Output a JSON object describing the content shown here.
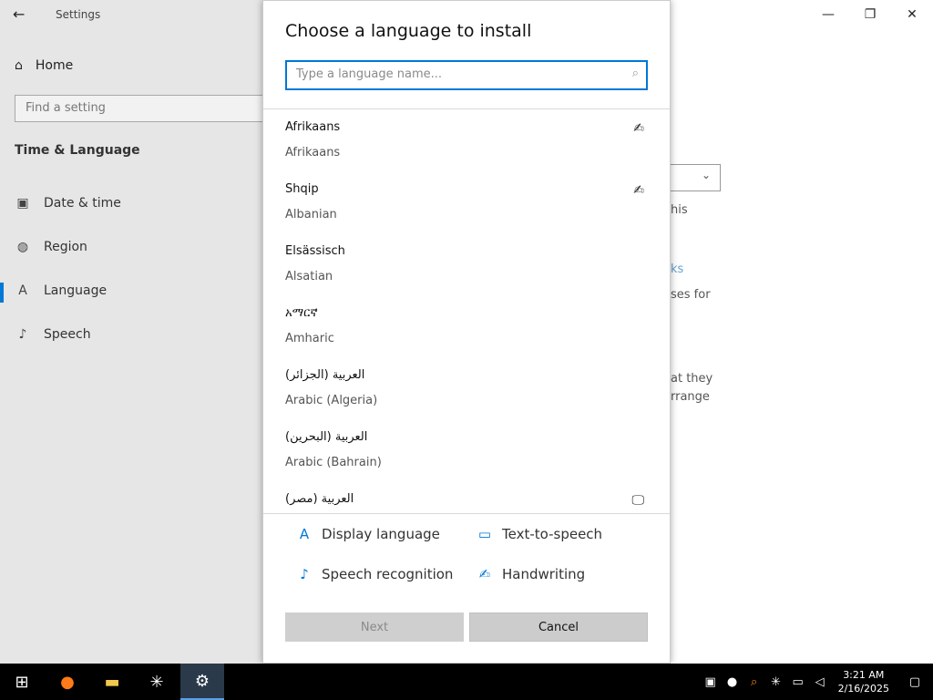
{
  "window": {
    "title": "Settings",
    "controls": {
      "minimize": "—",
      "restore": "❐",
      "close": "✕"
    }
  },
  "sidebar": {
    "home_label": "Home",
    "search_placeholder": "Find a setting",
    "section_title": "Time & Language",
    "items": [
      {
        "label": "Date & time",
        "icon": "calendar-icon",
        "glyph": "▣"
      },
      {
        "label": "Region",
        "icon": "globe-icon",
        "glyph": "◍"
      },
      {
        "label": "Language",
        "icon": "language-icon",
        "glyph": "A"
      },
      {
        "label": "Speech",
        "icon": "microphone-icon",
        "glyph": "♪"
      }
    ]
  },
  "background_fragments": [
    "his",
    "ks",
    "ses for",
    "at they",
    "rrange"
  ],
  "dialog": {
    "title": "Choose a language to install",
    "search_placeholder": "Type a language name...",
    "languages": [
      {
        "native": "Afrikaans",
        "english": "Afrikaans",
        "capability_icon": "handwriting-icon",
        "glyph": "✍"
      },
      {
        "native": "Shqip",
        "english": "Albanian",
        "capability_icon": "handwriting-icon",
        "glyph": "✍"
      },
      {
        "native": "Elsässisch",
        "english": "Alsatian",
        "capability_icon": "",
        "glyph": ""
      },
      {
        "native": "አማርኛ",
        "english": "Amharic",
        "capability_icon": "",
        "glyph": ""
      },
      {
        "native": "العربية (الجزائر)",
        "english": "Arabic (Algeria)",
        "capability_icon": "",
        "glyph": ""
      },
      {
        "native": "العربية (البحرين)",
        "english": "Arabic (Bahrain)",
        "capability_icon": "",
        "glyph": ""
      },
      {
        "native": "العربية (مصر)",
        "english": "",
        "capability_icon": "text-to-speech-icon",
        "glyph": "🖵"
      }
    ],
    "features": [
      {
        "label": "Display language",
        "icon": "display-language-icon",
        "glyph": "A"
      },
      {
        "label": "Text-to-speech",
        "icon": "text-to-speech-icon",
        "glyph": "▭"
      },
      {
        "label": "Speech recognition",
        "icon": "microphone-icon",
        "glyph": "♪"
      },
      {
        "label": "Handwriting",
        "icon": "handwriting-icon",
        "glyph": "✍"
      }
    ],
    "buttons": {
      "next": "Next",
      "cancel": "Cancel"
    }
  },
  "taskbar": {
    "apps": [
      {
        "name": "start-button",
        "glyph": "⊞"
      },
      {
        "name": "firefox-icon",
        "glyph": "●"
      },
      {
        "name": "file-explorer-icon",
        "glyph": "▬"
      },
      {
        "name": "snowflake-app-icon",
        "glyph": "✳"
      },
      {
        "name": "settings-app-icon",
        "glyph": "⚙"
      }
    ],
    "tray_icons": [
      "network-warning-icon",
      "drop-icon",
      "search-tray-icon",
      "snowflake-tray-icon",
      "network-icon",
      "volume-icon"
    ],
    "time": "3:21 AM",
    "date": "2/16/2025"
  }
}
